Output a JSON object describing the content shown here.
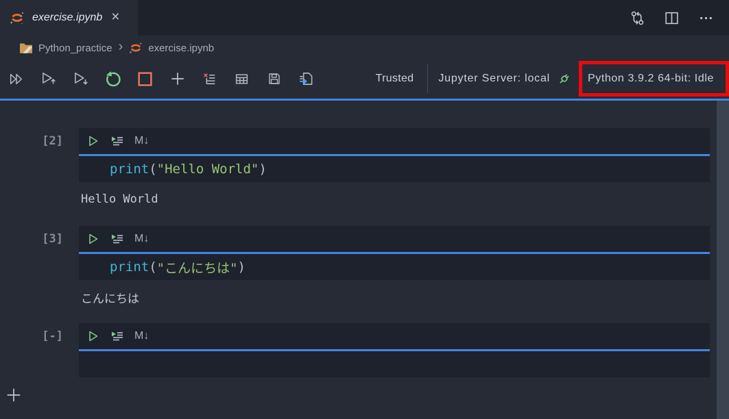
{
  "tab": {
    "title": "exercise.ipynb",
    "close": "×"
  },
  "breadcrumb": {
    "folder": "Python_practice",
    "separator": "›",
    "file": "exercise.ipynb"
  },
  "toolbar": {
    "trusted": "Trusted",
    "server": "Jupyter Server: local",
    "kernel": "Python 3.9.2 64-bit: Idle"
  },
  "cell_toolbar": {
    "markdown_label": "M↓"
  },
  "cells": [
    {
      "label": "[2]",
      "code": {
        "keyword": "print",
        "open": "(",
        "string": "\"Hello World\"",
        "close": ")"
      },
      "output": "Hello World"
    },
    {
      "label": "[3]",
      "code": {
        "keyword": "print",
        "open": "(",
        "string": "\"こんにちは\"",
        "close": ")"
      },
      "output": "こんにちは"
    },
    {
      "label": "[-]",
      "code": {
        "keyword": "",
        "open": "",
        "string": "",
        "close": ""
      },
      "output": ""
    }
  ],
  "colors": {
    "accent_blue": "#4484e3",
    "annotation_red": "#e90b0b",
    "icon_green": "#7ecb89",
    "stop_red": "#ef7866",
    "jupyter_orange": "#e46f33"
  }
}
